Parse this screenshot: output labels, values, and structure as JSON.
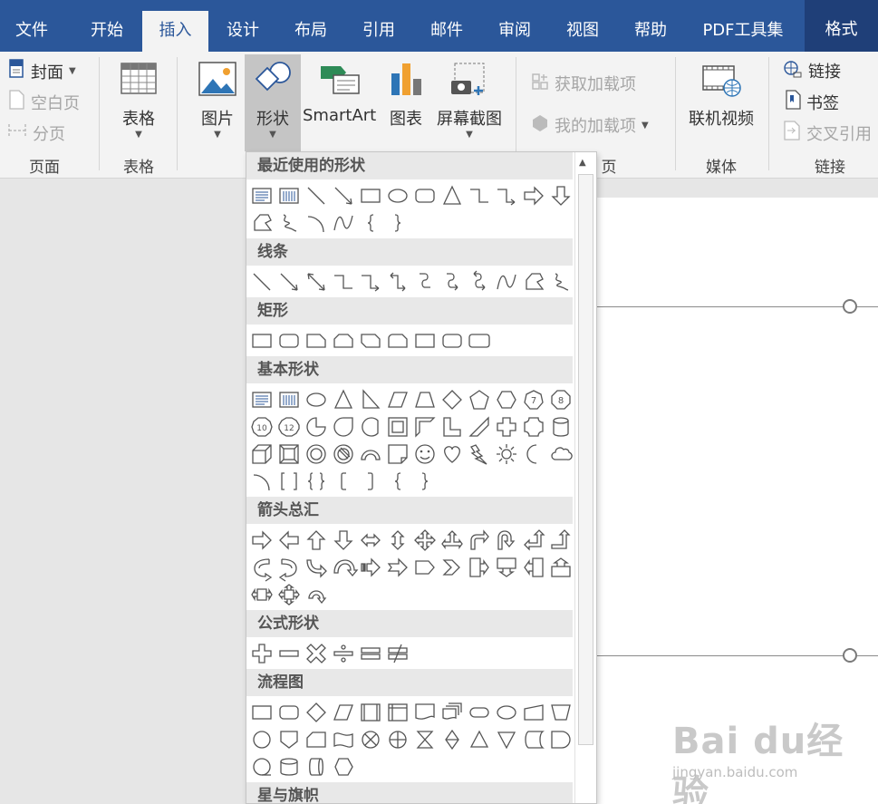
{
  "tabs": [
    "文件",
    "开始",
    "插入",
    "设计",
    "布局",
    "引用",
    "邮件",
    "审阅",
    "视图",
    "帮助",
    "PDF工具集",
    "格式"
  ],
  "active_tab_index": 2,
  "ribbon": {
    "pages": {
      "cover": "封面",
      "blank": "空白页",
      "break": "分页",
      "group": "页面"
    },
    "table": {
      "label": "表格",
      "group": "表格"
    },
    "illustrations": {
      "picture": "图片",
      "shapes": "形状",
      "smartart": "SmartArt",
      "chart": "图表",
      "screenshot": "屏幕截图"
    },
    "addins": {
      "get": "获取加载项",
      "mine": "我的加载项",
      "group_tail": "页"
    },
    "media": {
      "video": "联机视频",
      "group": "媒体"
    },
    "links": {
      "link": "链接",
      "bookmark": "书签",
      "crossref": "交叉引用",
      "group": "链接"
    }
  },
  "shapes_panel": {
    "sections": [
      {
        "title": "最近使用的形状",
        "rows": [
          [
            "textbox",
            "vtextbox",
            "line",
            "arrow",
            "rect",
            "ellipse",
            "roundrect",
            "triangle",
            "elbow",
            "elbowarrow",
            "rightarrow",
            "downarrow"
          ],
          [
            "freeform",
            "scribble",
            "arc",
            "curve",
            "lbrace",
            "rbrace"
          ]
        ]
      },
      {
        "title": "线条",
        "rows": [
          [
            "line",
            "arrow",
            "dblarrow",
            "elbow",
            "elbowarrow",
            "elbowdbl",
            "curveconn",
            "curvearrow",
            "curvedbl",
            "curve",
            "freeform",
            "scribble"
          ]
        ]
      },
      {
        "title": "矩形",
        "rows": [
          [
            "rect",
            "roundrect",
            "snip1",
            "snip2",
            "snipdiag",
            "sniprnd",
            "rect",
            "roundrect",
            "roundrect2"
          ]
        ]
      },
      {
        "title": "基本形状",
        "rows": [
          [
            "textbox",
            "vtextbox",
            "ellipse",
            "triangle",
            "rtriangle",
            "parallelogram",
            "trapezoid",
            "diamond",
            "pentagon",
            "hexagon",
            "heptagon",
            "octagon"
          ],
          [
            "decagon",
            "dodecagon",
            "pie",
            "teardrop",
            "chord",
            "frame",
            "halfframe",
            "lshape",
            "diagstripe",
            "cross",
            "plaque",
            "can"
          ],
          [
            "cube",
            "bevel",
            "donut",
            "nosymbol",
            "blockarc",
            "foldedcorner",
            "smiley",
            "heart",
            "lightning",
            "sun",
            "moon",
            "cloud"
          ],
          [
            "arc",
            "brackets",
            "braces",
            "lbracket",
            "rbracket",
            "lbrace",
            "rbrace"
          ]
        ]
      },
      {
        "title": "箭头总汇",
        "rows": [
          [
            "rightarrow",
            "leftarrow",
            "uparrow",
            "downarrow",
            "lrarrow",
            "udarrow",
            "quadarrow",
            "lruparrow",
            "bentarrow",
            "uturn",
            "leftuparrow",
            "bentuparrow"
          ],
          [
            "curvedright",
            "curvedleft",
            "curvedup",
            "curveddown",
            "stripedright",
            "notchedright",
            "pentagonarrow",
            "chevron",
            "rightcallout",
            "downcallout",
            "leftcallout",
            "upcallout"
          ],
          [
            "lrcallout",
            "quadcallout",
            "circulararrow"
          ]
        ]
      },
      {
        "title": "公式形状",
        "rows": [
          [
            "plus",
            "minus",
            "multiply",
            "divide",
            "equal",
            "notequal"
          ]
        ]
      },
      {
        "title": "流程图",
        "rows": [
          [
            "rect",
            "roundrect",
            "diamond",
            "parallelogram",
            "predefined",
            "internal",
            "document",
            "multidoc",
            "terminator",
            "ellipse",
            "manualinput",
            "manualop"
          ],
          [
            "connector",
            "offpage",
            "card",
            "punchedtape",
            "sumjunction",
            "or",
            "collate",
            "sort",
            "extract",
            "merge",
            "storeddata",
            "delay"
          ],
          [
            "seqaccess",
            "magdisk",
            "directaccess",
            "display"
          ]
        ]
      },
      {
        "title": "星与旗帜",
        "rows": []
      }
    ]
  },
  "watermark": {
    "logo": "Bai du经验",
    "url": "jingyan.baidu.com"
  }
}
